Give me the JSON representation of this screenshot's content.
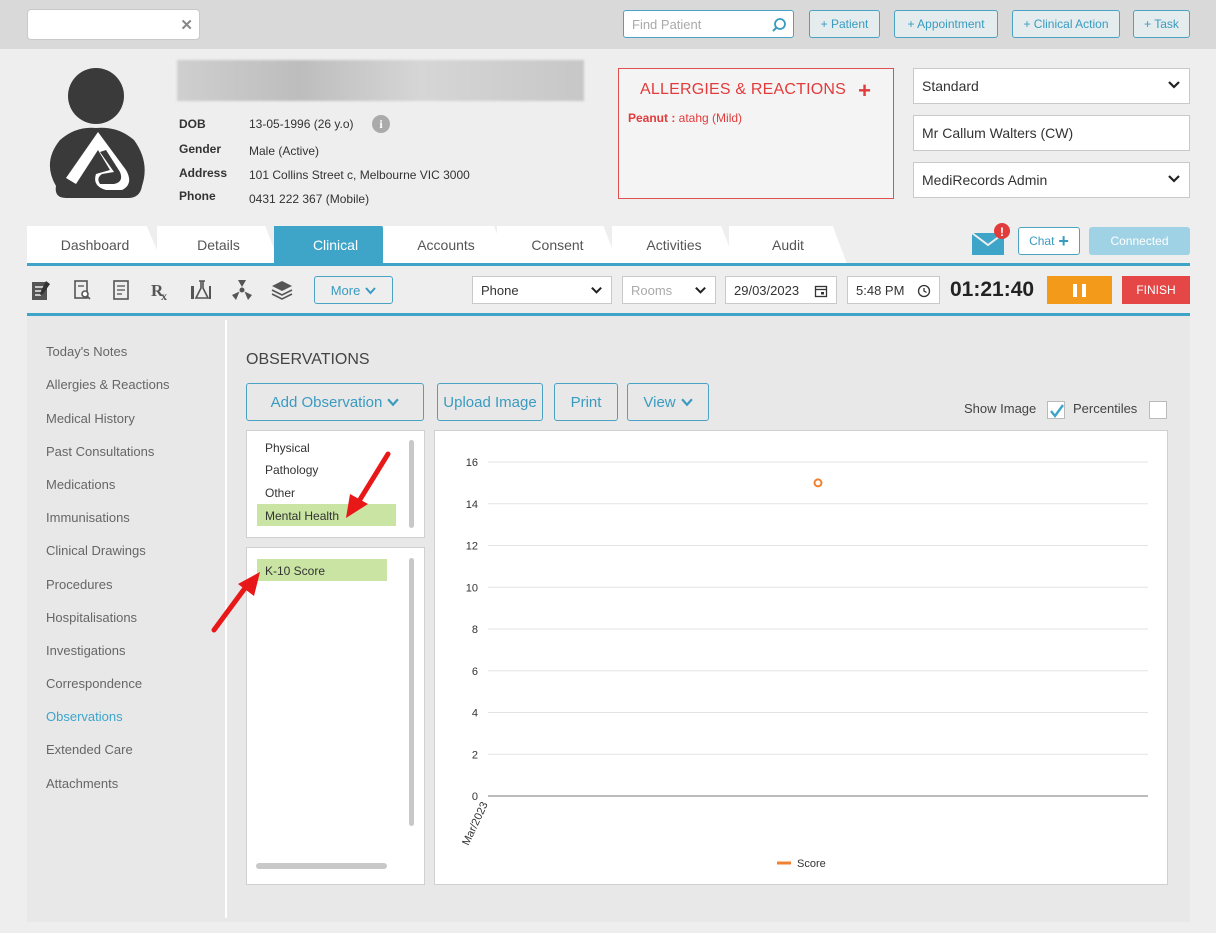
{
  "topbar": {
    "search_placeholder": "Find Patient",
    "buttons": [
      "+ Patient",
      "+ Appointment",
      "+ Clinical Action",
      "+ Task"
    ]
  },
  "patient": {
    "dob_label": "DOB",
    "dob_value": "13-05-1996 (26 y.o)",
    "gender_label": "Gender",
    "gender_value": "Male (Active)",
    "address_label": "Address",
    "address_value": "101 Collins Street c, Melbourne VIC 3000",
    "phone_label": "Phone",
    "phone_value": "0431 222 367 (Mobile)"
  },
  "allergies": {
    "title": "ALLERGIES & REACTIONS",
    "item_name": "Peanut :",
    "item_detail": " atahg (Mild)"
  },
  "selectors": {
    "billing": "Standard",
    "doctor": "Mr Callum Walters (CW)",
    "account": "MediRecords Admin"
  },
  "tabs": [
    "Dashboard",
    "Details",
    "Clinical",
    "Accounts",
    "Consent",
    "Activities",
    "Audit"
  ],
  "active_tab": "Clinical",
  "chat": {
    "label": "Chat",
    "connected": "Connected"
  },
  "toolbar": {
    "more": "More",
    "mode": "Phone",
    "rooms_placeholder": "Rooms",
    "date": "29/03/2023",
    "time": "5:48 PM",
    "timer": "01:21:40",
    "finish": "FINISH"
  },
  "sidebar": [
    "Today's Notes",
    "Allergies & Reactions",
    "Medical History",
    "Past Consultations",
    "Medications",
    "Immunisations",
    "Clinical Drawings",
    "Procedures",
    "Hospitalisations",
    "Investigations",
    "Correspondence",
    "Observations",
    "Extended Care",
    "Attachments"
  ],
  "sidebar_active": "Observations",
  "observations": {
    "title": "OBSERVATIONS",
    "add": "Add Observation",
    "upload": "Upload Image",
    "print": "Print",
    "view": "View",
    "show_image": "Show Image",
    "percentiles": "Percentiles",
    "categories": [
      "Physical",
      "Pathology",
      "Other",
      "Mental Health"
    ],
    "selected_category": "Mental Health",
    "items": [
      "K-10 Score"
    ]
  },
  "colors": {
    "accent": "#3ea5c9",
    "allergy": "#e23b3b",
    "pause": "#f39a1a",
    "finish": "#e54646",
    "highlight": "#c9e4a3",
    "series": "#f0812e"
  },
  "chart_data": {
    "type": "scatter",
    "categories": [
      "Mar/2023"
    ],
    "yticks": [
      0,
      2,
      4,
      6,
      8,
      10,
      12,
      14,
      16
    ],
    "ylim": [
      0,
      16
    ],
    "series": [
      {
        "name": "Score",
        "x": [
          "Mar/2023"
        ],
        "values": [
          15
        ]
      }
    ],
    "legend": "bottom",
    "grid": true
  }
}
